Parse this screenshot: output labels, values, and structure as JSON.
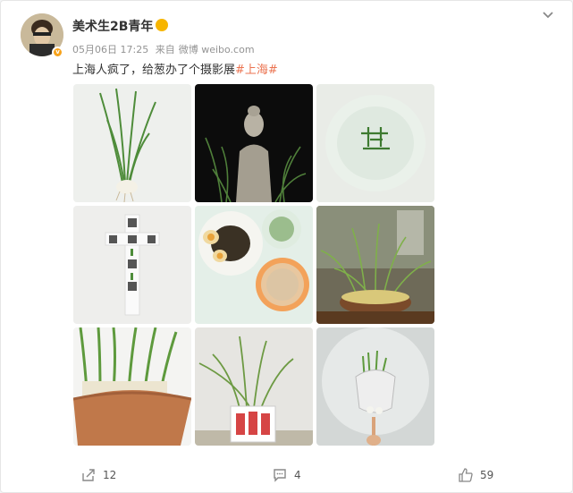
{
  "post": {
    "username": "美术生2B青年",
    "timestamp": "05月06日 17:25",
    "source_prefix": "来自",
    "source": "微博 weibo.com",
    "text_main": "上海人疯了，给葱办了个摄影展",
    "hashtag": "#上海#"
  },
  "images": [
    {
      "icon": "scallion-photo"
    },
    {
      "icon": "buddha-scallion-photo"
    },
    {
      "icon": "plate-scallion-photo"
    },
    {
      "icon": "qr-cross-photo"
    },
    {
      "icon": "food-dishes-photo"
    },
    {
      "icon": "basket-scallion-photo"
    },
    {
      "icon": "pot-scallion-photo"
    },
    {
      "icon": "scallion-picture-photo"
    },
    {
      "icon": "scallion-bag-photo"
    }
  ],
  "actions": {
    "share_count": "12",
    "comment_count": "4",
    "like_count": "59"
  },
  "colors": {
    "hashtag": "#eb7350",
    "meta_gray": "#939393",
    "verified_badge": "#f7a21b"
  }
}
